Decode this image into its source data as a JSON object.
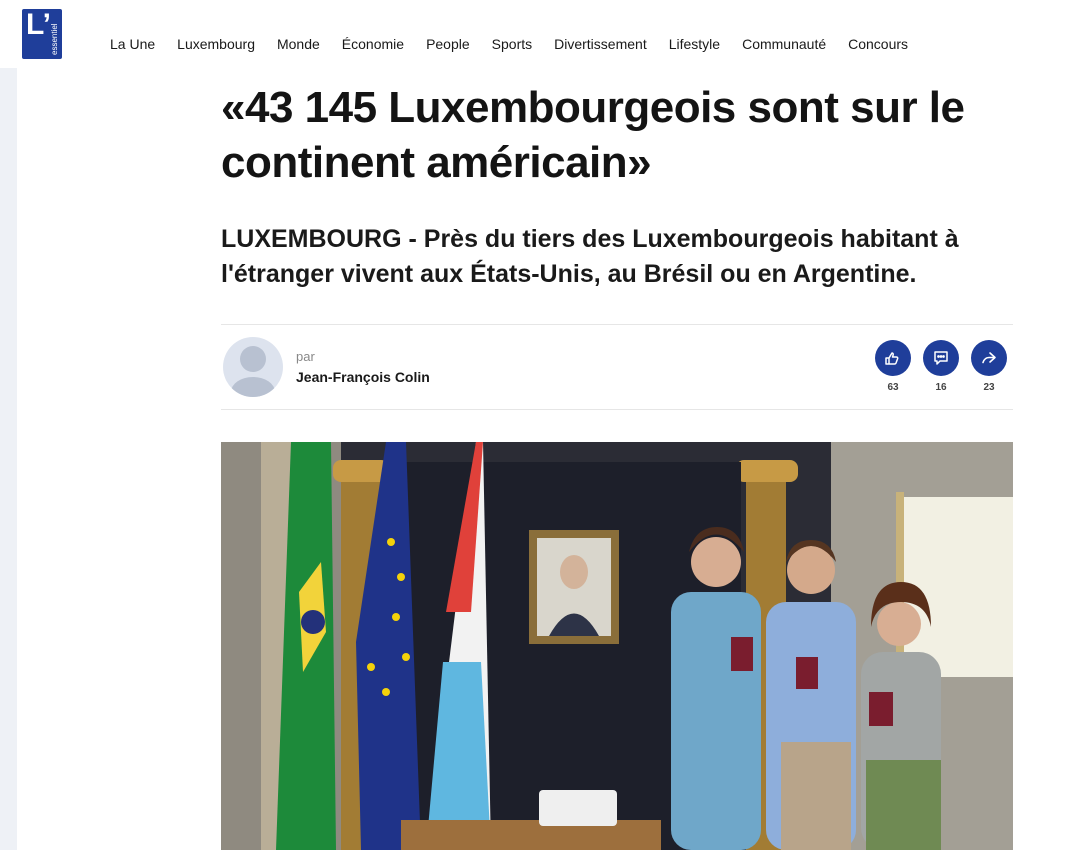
{
  "brand": {
    "logo_letter": "L’",
    "logo_word": "essentiel"
  },
  "nav": [
    "La Une",
    "Luxembourg",
    "Monde",
    "Économie",
    "People",
    "Sports",
    "Divertissement",
    "Lifestyle",
    "Communauté",
    "Concours"
  ],
  "article": {
    "title": "«43 145 Luxembourgeois sont sur le continent américain»",
    "lead": "LUXEMBOURG - Près du tiers des Luxembourgeois habitant à l'étranger vivent aux États-Unis, au Brésil ou en Argentine.",
    "byline_prefix": "par",
    "author": "Jean-François Colin"
  },
  "actions": [
    {
      "icon": "reactions-icon",
      "count": "63"
    },
    {
      "icon": "comments-icon",
      "count": "16"
    },
    {
      "icon": "share-icon",
      "count": "23"
    }
  ],
  "colors": {
    "brand_blue": "#1f3e9a"
  }
}
